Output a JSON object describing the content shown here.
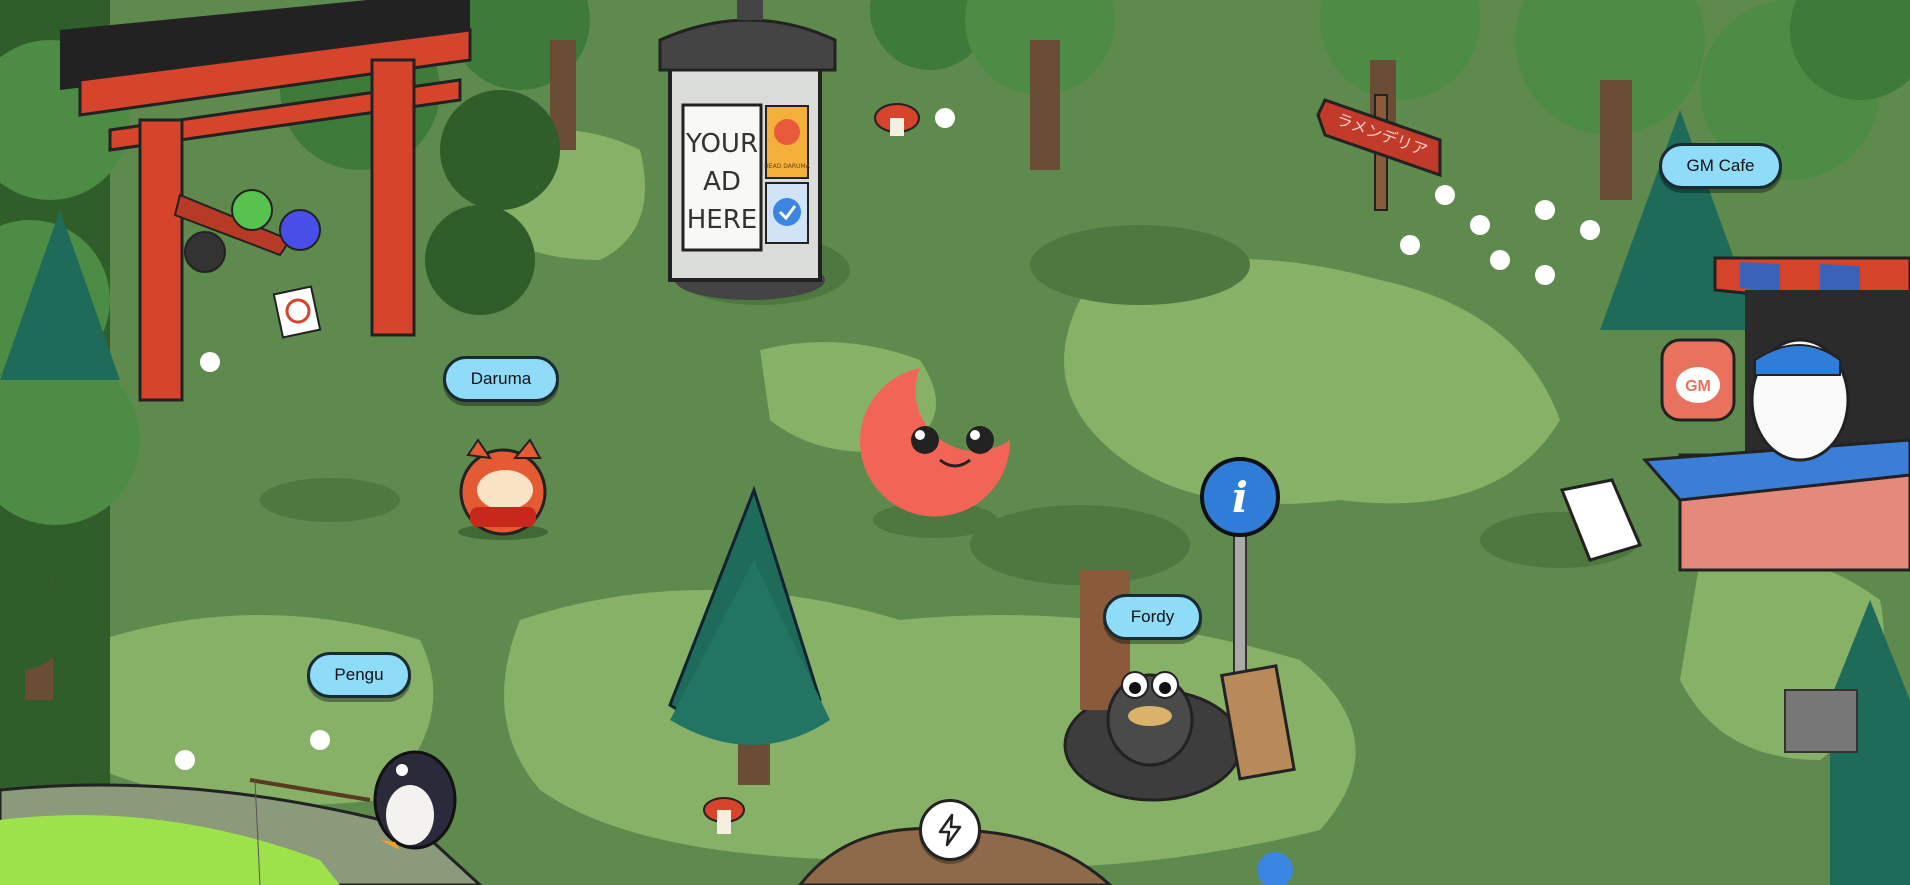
{
  "characters": [
    {
      "id": "daruma",
      "label": "Daruma"
    },
    {
      "id": "pengu",
      "label": "Pengu"
    },
    {
      "id": "fordy",
      "label": "Fordy"
    }
  ],
  "places": {
    "cafe": {
      "label": "GM Cafe",
      "cup_text": "GM"
    }
  },
  "ad_pillar": {
    "line1": "YOUR",
    "line2": "AD",
    "line3": "HERE",
    "poster_text": "HEAD DARUMA"
  },
  "sign": {
    "text": "ラメンデリア"
  },
  "info_sign": {
    "text": "i"
  },
  "action_button": {
    "icon": "bolt-icon"
  },
  "colors": {
    "label_bg": "#8fdcf8",
    "grass": "#5e8a4e",
    "torii": "#d6442b",
    "player": "#f26455"
  }
}
